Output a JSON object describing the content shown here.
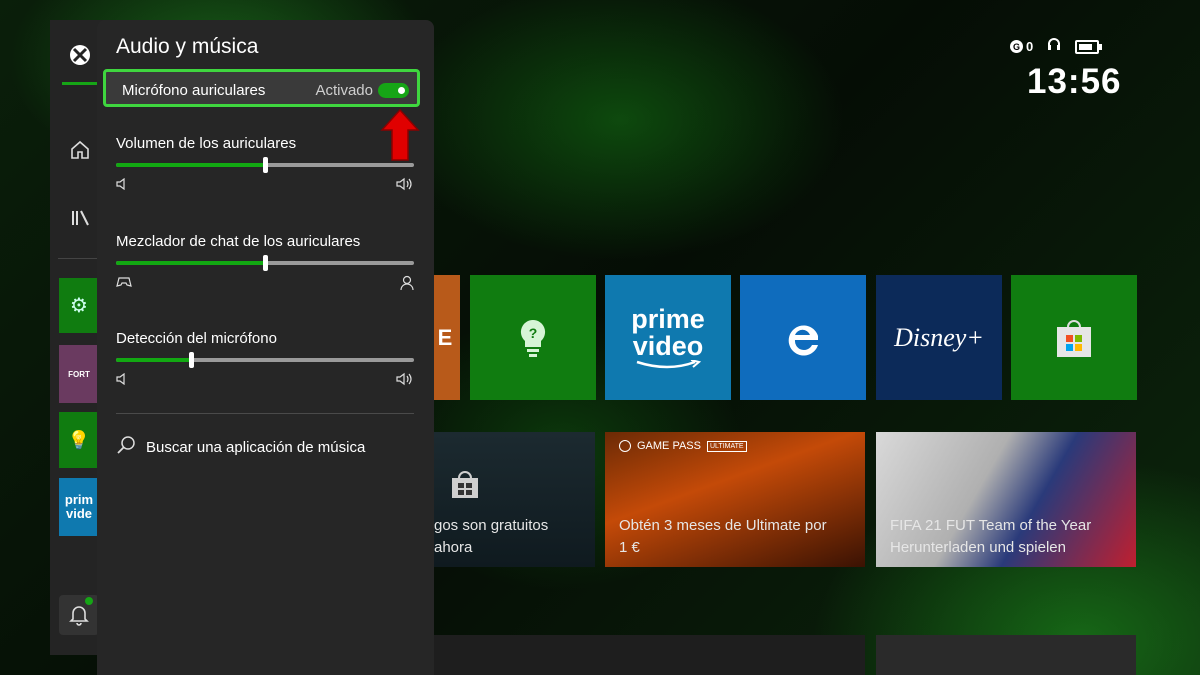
{
  "status": {
    "gamerscore": "0",
    "time": "13:56"
  },
  "panel": {
    "title": "Audio y música",
    "mic": {
      "label": "Micrófono auriculares",
      "value": "Activado",
      "on": true
    },
    "sliders": [
      {
        "label": "Volumen de los auriculares",
        "level": 0.5,
        "left_icon": "speaker-low-icon",
        "right_icon": "speaker-high-icon"
      },
      {
        "label": "Mezclador de chat de los auriculares",
        "level": 0.5,
        "left_icon": "controller-icon",
        "right_icon": "person-icon"
      },
      {
        "label": "Detección del micrófono",
        "level": 0.25,
        "left_icon": "speaker-low-icon",
        "right_icon": "speaker-high-icon"
      }
    ],
    "search_label": "Buscar una aplicación de música"
  },
  "tiles": {
    "prime_line1": "prime",
    "prime_line2": "video",
    "disney": "Disney+",
    "fortnite_partial": "E"
  },
  "wide_tiles": {
    "store_line1": "gos son gratuitos",
    "store_line2": "ahora",
    "gamepass_badge": "GAME PASS",
    "gamepass_ultimate": "ULTIMATE",
    "gamepass_line1": "Obtén 3 meses de Ultimate por",
    "gamepass_line2": "1 €",
    "fifa_line1": "FIFA 21 FUT Team of the Year",
    "fifa_line2": "Herunterladen und spielen"
  },
  "rail": {
    "fortnite": "FORT",
    "prime_line1": "prim",
    "prime_line2": "vide"
  },
  "colors": {
    "accent": "#107c10",
    "focus": "#3fd63f",
    "toggle": "#16a516",
    "arrow": "#e00000"
  }
}
